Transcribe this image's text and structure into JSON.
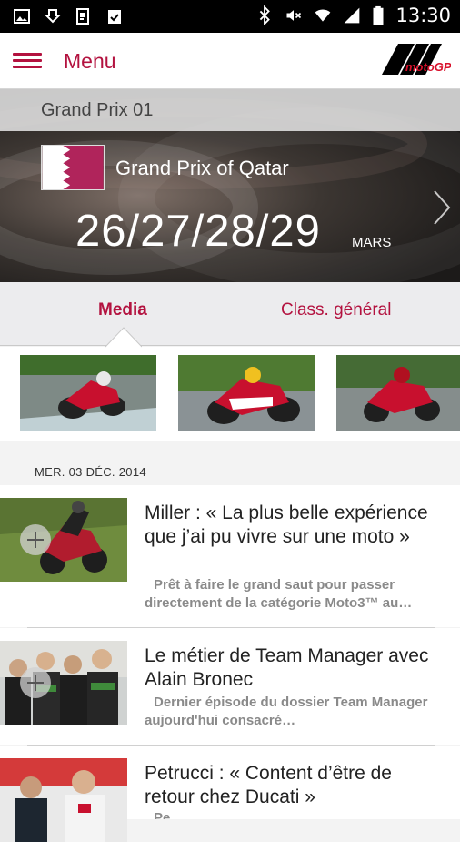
{
  "status_bar": {
    "time": "13:30"
  },
  "app_bar": {
    "menu_label": "Menu",
    "logo_text": "motoGP"
  },
  "hero": {
    "round": "Grand Prix 01",
    "name": "Grand Prix of Qatar",
    "dates": "26/27/28/29",
    "month": "MARS"
  },
  "tabs": [
    {
      "label": "Media",
      "active": true
    },
    {
      "label": "Class. général",
      "active": false
    }
  ],
  "feed": {
    "date_heading": "MER. 03 DÉC. 2014",
    "articles": [
      {
        "title": "Miller : « La plus belle expérience que j’ai pu vivre sur une moto »",
        "desc": "Prêt à faire le grand saut pour passer directement de la catégorie Moto3™ au…"
      },
      {
        "title": "Le métier de Team Manager avec Alain Bronec",
        "desc": "Dernier épisode du dossier Team Manager aujourd'hui consacré…"
      },
      {
        "title": "Petrucci : « Content d’être de retour chez Ducati »",
        "desc": "Pe…"
      }
    ]
  },
  "colors": {
    "accent": "#b3123f",
    "flag_maroon": "#8a1538"
  }
}
